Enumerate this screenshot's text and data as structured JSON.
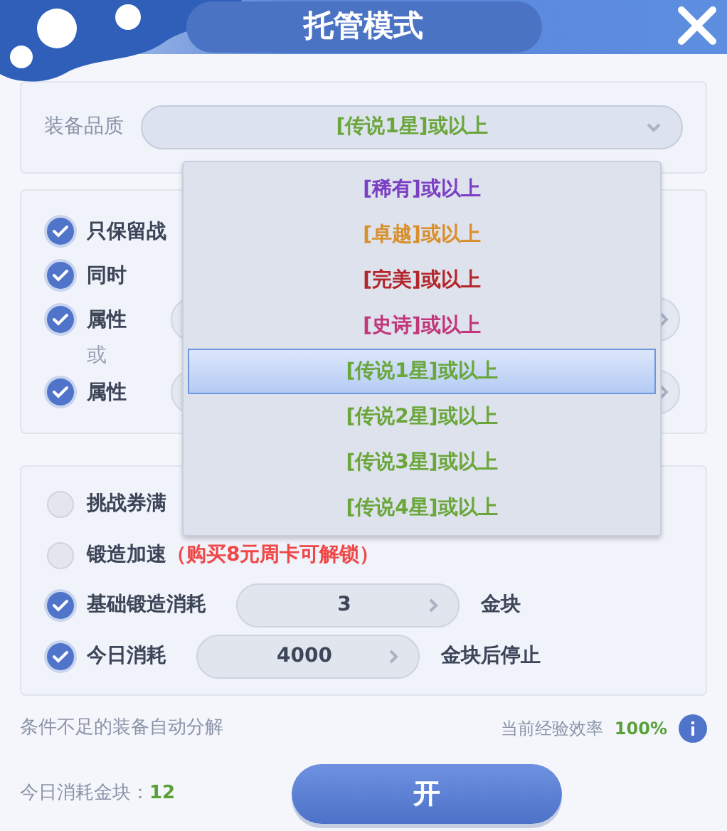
{
  "window": {
    "title": "托管模式"
  },
  "quality": {
    "label": "装备品质",
    "value": "[传说1星]或以上",
    "color": "#6aa63a",
    "expanded": true
  },
  "dropdown": [
    {
      "label": "[稀有]或以上",
      "color": "#7b3fc4",
      "selected": false
    },
    {
      "label": "[卓越]或以上",
      "color": "#d98f2b",
      "selected": false
    },
    {
      "label": "[完美]或以上",
      "color": "#b3262b",
      "selected": false
    },
    {
      "label": "[史诗]或以上",
      "color": "#c2367a",
      "selected": false
    },
    {
      "label": "[传说1星]或以上",
      "color": "#6aa63a",
      "selected": true
    },
    {
      "label": "[传说2星]或以上",
      "color": "#6aa63a",
      "selected": false
    },
    {
      "label": "[传说3星]或以上",
      "color": "#6aa63a",
      "selected": false
    },
    {
      "label": "[传说4星]或以上",
      "color": "#6aa63a",
      "selected": false
    }
  ],
  "filters": [
    {
      "kind": "check",
      "label": "只保留战",
      "checked": true
    },
    {
      "kind": "check",
      "label": "同时",
      "checked": true
    },
    {
      "kind": "field",
      "label": "属性",
      "checked": true
    },
    {
      "kind": "note",
      "label": "或"
    },
    {
      "kind": "field",
      "label": "属性",
      "checked": true
    }
  ],
  "options": [
    {
      "kind": "check",
      "label": "挑战券满",
      "checked": false
    },
    {
      "kind": "locked",
      "label": "锻造加速",
      "note": "（购买8元周卡可解锁）",
      "checked": false
    },
    {
      "kind": "stepper",
      "label": "基础锻造消耗",
      "value": "3",
      "unit": "金块",
      "checked": true
    },
    {
      "kind": "stepper",
      "label": "今日消耗",
      "value": "4000",
      "unit": "金块后停止",
      "checked": true
    }
  ],
  "footer": {
    "auto_note": "条件不足的装备自动分解",
    "rate_label": "当前经验效率",
    "rate_value": "100%",
    "spent_label": "今日消耗金块：",
    "spent_value": "12",
    "start_button": "开"
  }
}
